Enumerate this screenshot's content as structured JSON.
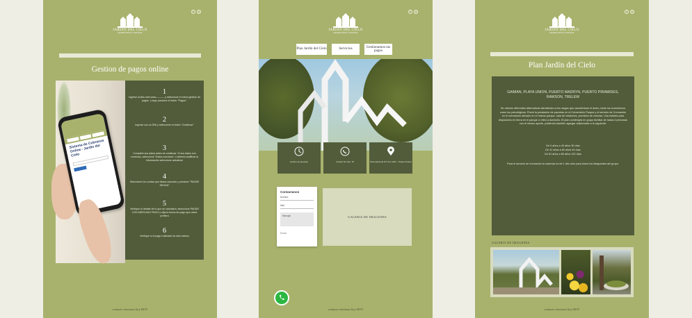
{
  "brand": {
    "name": "JARDÍN DEL CIELO",
    "tagline": "CEMENTERIO PARQUE"
  },
  "colors": {
    "panel_green": "#a8b26d",
    "dark_olive": "#525c3b",
    "light_bar": "#e8ead6",
    "background": "#eeeee4",
    "whatsapp": "#2bb741"
  },
  "icons": {
    "social": [
      "facebook-icon",
      "instagram-icon"
    ],
    "info": [
      "clock-icon",
      "whatsapp-icon",
      "location-pin-icon"
    ],
    "floating": "whatsapp-icon"
  },
  "panel1": {
    "heading": "Gestion de pagos online",
    "steps": [
      {
        "number": "1",
        "text": "Ingrese al sitio web www.——— y seleccione el menú gestión de pagos. Luego presione el botón \"Pagos\"."
      },
      {
        "number": "2",
        "text": "Ingrese con su DNI y seleccione el botón \"Continuar\""
      },
      {
        "number": "3",
        "text": "Complete sus datos antes de continuar. Si sus datos son correctos, seleccione \"Datos correctos\" o deberá modificar la información seleccione actualizar"
      },
      {
        "number": "4",
        "text": "Seleccione los cuotas que desea cancelar y presione \"PAGAR DEUDA\""
      },
      {
        "number": "5",
        "text": "Verifique el detalle de lo que se cancelará, seleccione PAGAR CON MERCADO PAGO y elija la forma de pago que usted prefiera"
      },
      {
        "number": "6",
        "text": "Verifique si el pago realizado ha sido exitoso"
      }
    ],
    "phone_screen_title": "Sistema de Cobranza Online - Jardín del Cielo",
    "footer": "contacto envianos hoy HOY"
  },
  "panel2": {
    "nav": [
      "Plan Jardín del Cielo",
      "Servicios",
      "Gestionamos tus pagos"
    ],
    "info_boxes": [
      {
        "icon": "clock-icon",
        "text": "Horario de atención"
      },
      {
        "icon": "whatsapp-icon",
        "text": "Celular Tel. Fijo: 76"
      },
      {
        "icon": "location-pin-icon",
        "text": "Ruta Nacional N°3 Km 1444 · Trelew Chubut"
      }
    ],
    "contact_form": {
      "title": "Contactanos",
      "fields": [
        "Nombre",
        "Mail",
        "Mensaje"
      ],
      "submit": "Enviar"
    },
    "gallery_label": "GALERIA DE IMAGENES",
    "footer": "contacto envianos hoy HOY"
  },
  "panel3": {
    "heading": "Plan Jardín del Cielo",
    "cities": "GAIMAN, PLAYA UNION, PUERTO MADRYN, PUERTO PIRAMIDES, RAWSON, TRELEW",
    "description": "Se ofrecen diferentes alternativas atendiendo a los rasgos que caracterizan el duelo, tanto los económicos como los psicológicos. Prevé la prestación de parcelas en el Cementerio Parque y el servicio de Cremación en el crematorio ubicado en el mismo parque, sala de velatorios, previsión de cenizas. Una estadía para disposición en tierra en el parque o retiro a domicilio. El plan contempla en grupo familiar de hasta 4 personas con el mismo aporte, pudiendo también agregar adicionales a la siguiente:",
    "ages": [
      "De 0 años a 40 años 30 días",
      "De 41 años a 60 años 60 días",
      "De 61 años a 80 años 120 días"
    ],
    "note": "Para el servicio de cremación la carencia es de 1 año sólo para todos los integrantes del grupo.",
    "gallery_title": "GALERIA DE IMAGENES",
    "footer": "contacto envianos hoy HOY"
  }
}
